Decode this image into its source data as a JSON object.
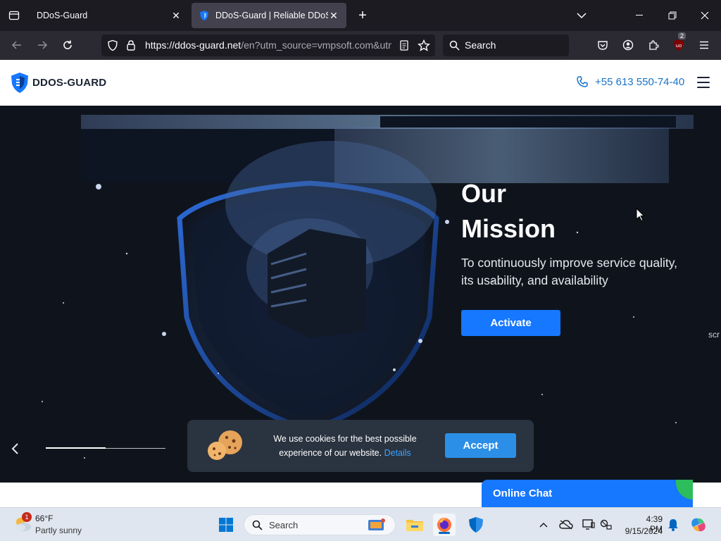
{
  "browser": {
    "tabs": [
      {
        "title": "DDoS-Guard",
        "active": false
      },
      {
        "title": "DDoS-Guard | Reliable DDoS Protection",
        "active": true
      }
    ],
    "url_main": "https://ddos-guard.net",
    "url_rest": "/en?utm_source=vmpsoft.com&utm",
    "search_placeholder": "Search",
    "extension_badge": "2"
  },
  "site": {
    "logo": "DDOS-GUARD",
    "phone": "+55 613 550-74-40"
  },
  "hero": {
    "title_line1": "Our",
    "title_line2": "Mission",
    "subtitle": "To continuously improve service quality, its usability, and availability",
    "cta": "Activate",
    "side_text": "scr",
    "slider_progress": 0.5
  },
  "cookie": {
    "text": "We use cookies for the best possible experience of our website.",
    "link": "Details",
    "accept": "Accept"
  },
  "chat": {
    "label": "Online Chat"
  },
  "taskbar": {
    "weather_temp": "66°F",
    "weather_desc": "Partly sunny",
    "weather_badge": "1",
    "search_placeholder": "Search",
    "time": "4:39 PM",
    "date": "9/15/2024"
  },
  "colors": {
    "accent_blue": "#1677ff",
    "link_blue": "#1a73c8",
    "hero_bg": "#0f141c"
  }
}
